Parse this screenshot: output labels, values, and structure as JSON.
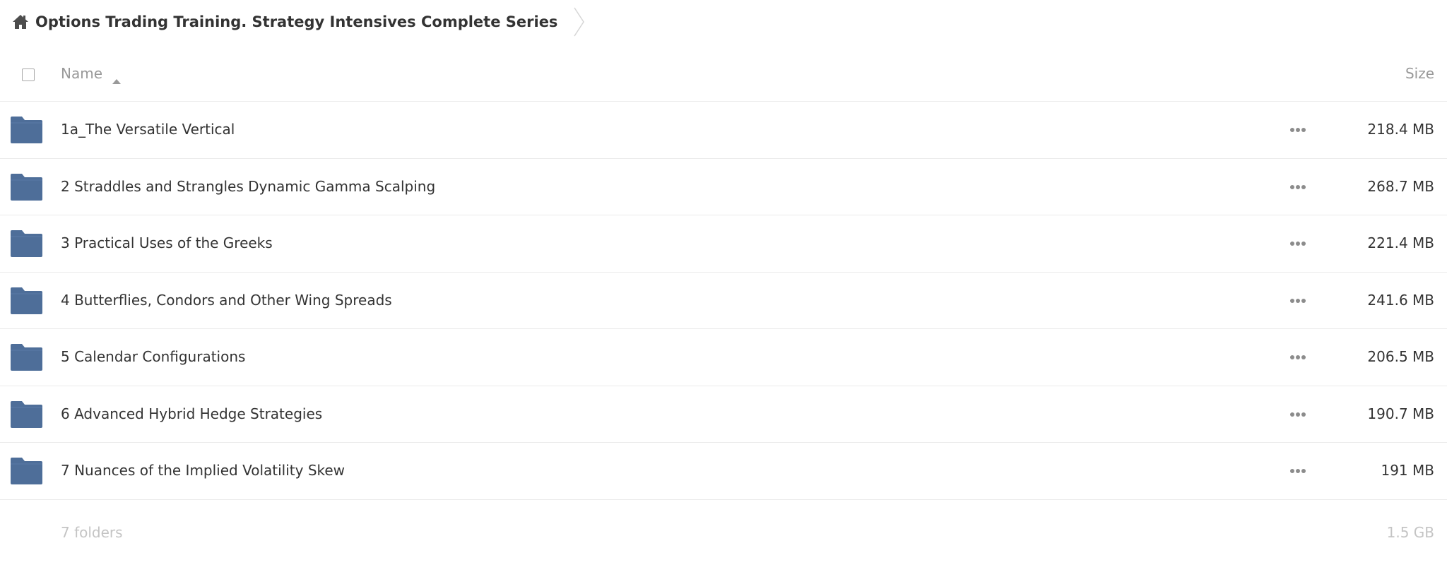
{
  "breadcrumb": {
    "home_icon": "home-icon",
    "current": "Options Trading Training. Strategy Intensives Complete Series"
  },
  "header": {
    "name_label": "Name",
    "size_label": "Size",
    "sort": "ascending"
  },
  "folders": [
    {
      "name": "1a_The Versatile Vertical",
      "size": "218.4 MB"
    },
    {
      "name": "2 Straddles and Strangles Dynamic Gamma Scalping",
      "size": "268.7 MB"
    },
    {
      "name": "3 Practical Uses of the Greeks",
      "size": "221.4 MB"
    },
    {
      "name": "4 Butterflies, Condors and Other Wing Spreads",
      "size": "241.6 MB"
    },
    {
      "name": "5 Calendar Configurations",
      "size": "206.5 MB"
    },
    {
      "name": "6 Advanced Hybrid Hedge Strategies",
      "size": "190.7 MB"
    },
    {
      "name": "7 Nuances of the Implied Volatility Skew",
      "size": "191 MB"
    }
  ],
  "summary": {
    "count": "7 folders",
    "total_size": "1.5 GB"
  },
  "colors": {
    "folder": "#4e6e99",
    "muted_text": "#999999",
    "footer_text": "#c4c4c4",
    "divider": "#ebebeb"
  }
}
